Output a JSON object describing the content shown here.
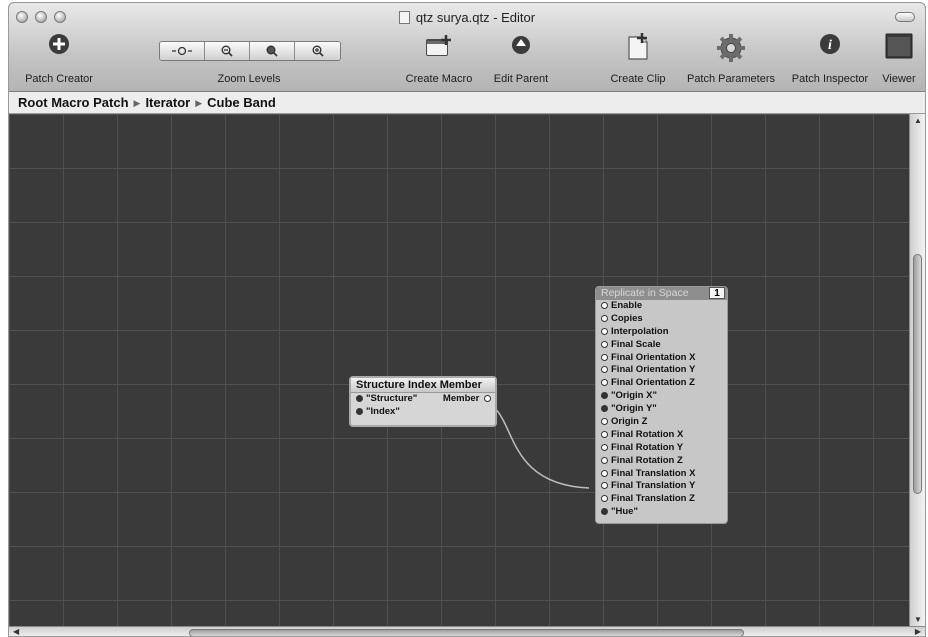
{
  "window": {
    "title": "qtz surya.qtz - Editor"
  },
  "toolbar": {
    "patch_creator": "Patch Creator",
    "zoom_levels": "Zoom Levels",
    "create_macro": "Create Macro",
    "edit_parent": "Edit Parent",
    "create_clip": "Create Clip",
    "patch_parameters": "Patch Parameters",
    "patch_inspector": "Patch Inspector",
    "viewer": "Viewer"
  },
  "breadcrumb": [
    "Root Macro Patch",
    "Iterator",
    "Cube Band"
  ],
  "patches": {
    "structure_index_member": {
      "title": "Structure Index Member",
      "inputs": [
        "\"Structure\"",
        "\"Index\""
      ],
      "output": "Member"
    },
    "replicate_in_space": {
      "title": "Replicate in Space",
      "badge": "1",
      "inputs": [
        {
          "label": "Enable",
          "filled": false
        },
        {
          "label": "Copies",
          "filled": false
        },
        {
          "label": "Interpolation",
          "filled": false
        },
        {
          "label": "Final Scale",
          "filled": false
        },
        {
          "label": "Final Orientation X",
          "filled": false
        },
        {
          "label": "Final Orientation Y",
          "filled": false
        },
        {
          "label": "Final Orientation Z",
          "filled": false
        },
        {
          "label": "\"Origin X\"",
          "filled": true
        },
        {
          "label": "\"Origin Y\"",
          "filled": true
        },
        {
          "label": "Origin Z",
          "filled": false
        },
        {
          "label": "Final Rotation X",
          "filled": false
        },
        {
          "label": "Final Rotation Y",
          "filled": false
        },
        {
          "label": "Final Rotation Z",
          "filled": false
        },
        {
          "label": "Final Translation X",
          "filled": false
        },
        {
          "label": "Final Translation Y",
          "filled": false
        },
        {
          "label": "Final Translation Z",
          "filled": false
        },
        {
          "label": "\"Hue\"",
          "filled": true
        }
      ]
    }
  },
  "colors": {
    "canvas": "#3a3a3a",
    "grid": "#505050",
    "connection": "#bdbdbd"
  }
}
